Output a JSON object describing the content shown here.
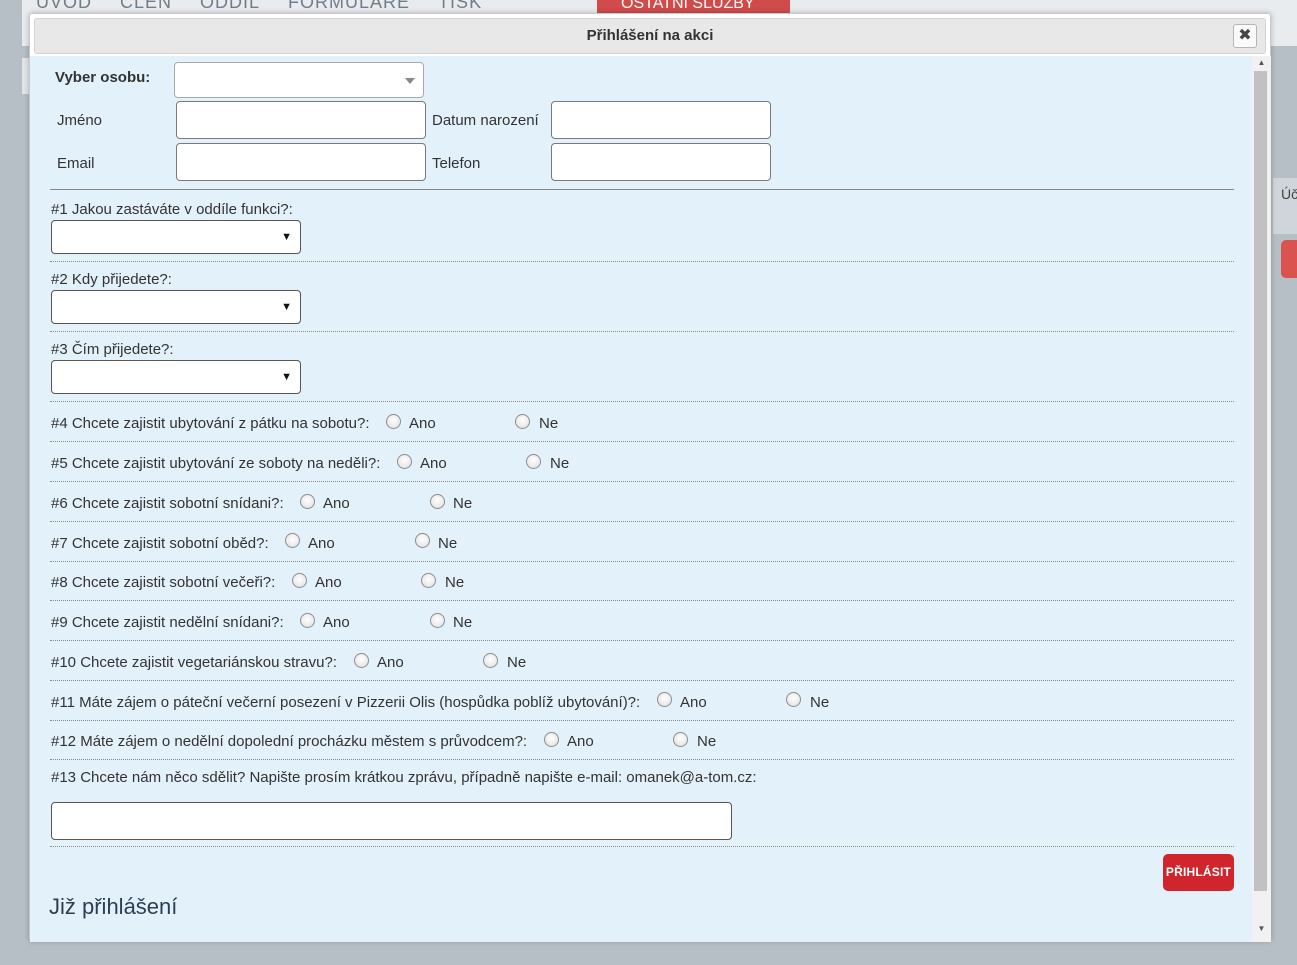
{
  "background": {
    "nav_items": [
      "ÚVOD",
      "ČLEN",
      "ODDÍL",
      "FORMULÁŘE",
      "TISK"
    ],
    "nav_red_item": "OSTATNÍ SLUŽBY",
    "right_panel_text": "Úč od"
  },
  "dialog": {
    "title": "Přihlášení na akci",
    "close_label": "✖"
  },
  "person": {
    "select_label": "Vyber osobu:",
    "select_value": "",
    "name_label": "Jméno",
    "name_value": "",
    "dob_label": "Datum narození",
    "dob_value": "",
    "email_label": "Email",
    "email_value": "",
    "phone_label": "Telefon",
    "phone_value": ""
  },
  "select_questions": [
    {
      "label": "#1 Jakou zastáváte v oddíle funkci?:",
      "value": ""
    },
    {
      "label": "#2 Kdy přijedete?:",
      "value": ""
    },
    {
      "label": "#3 Čím přijedete?:",
      "value": ""
    }
  ],
  "radio_questions": [
    {
      "label": "#4 Chcete zajistit ubytování z pátku na sobotu?:",
      "yes": "Ano",
      "no": "Ne",
      "selected": null
    },
    {
      "label": "#5 Chcete zajistit ubytování ze soboty na neděli?:",
      "yes": "Ano",
      "no": "Ne",
      "selected": null
    },
    {
      "label": "#6 Chcete zajistit sobotní snídani?:",
      "yes": "Ano",
      "no": "Ne",
      "selected": null
    },
    {
      "label": "#7 Chcete zajistit sobotní oběd?:",
      "yes": "Ano",
      "no": "Ne",
      "selected": null
    },
    {
      "label": "#8 Chcete zajistit sobotní večeři?:",
      "yes": "Ano",
      "no": "Ne",
      "selected": null
    },
    {
      "label": "#9 Chcete zajistit nedělní snídani?:",
      "yes": "Ano",
      "no": "Ne",
      "selected": null
    },
    {
      "label": "#10 Chcete zajistit vegetariánskou stravu?:",
      "yes": "Ano",
      "no": "Ne",
      "selected": null
    },
    {
      "label": "#11 Máte zájem o páteční večerní posezení v Pizzerii Olis (hospůdka poblíž ubytování)?:",
      "yes": "Ano",
      "no": "Ne",
      "selected": null
    },
    {
      "label": "#12 Máte zájem o nedělní dopolední procházku městem s průvodcem?:",
      "yes": "Ano",
      "no": "Ne",
      "selected": null
    }
  ],
  "message_question": {
    "label": "#13 Chcete nám něco sdělit? Napište prosím krátkou zprávu, případně napište e-mail: omanek@a-tom.cz:",
    "value": ""
  },
  "submit_label": "PŘIHLÁSIT",
  "already_registered_heading": "Již přihlášení",
  "colors": {
    "content_bg": "#e3f1fa",
    "submit_bg": "#d0252d",
    "overlay_bg": "#b6bfc5"
  },
  "icons": {
    "close": "close-icon",
    "dropdown": "chevron-down-icon"
  }
}
